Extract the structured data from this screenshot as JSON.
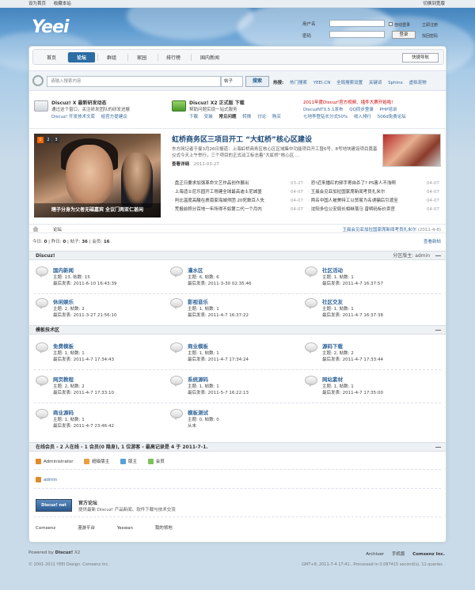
{
  "topbar": {
    "set_home": "设为首页",
    "bookmark": "收藏本站",
    "switch_style": "切换到宽版"
  },
  "logo": "Yeei",
  "login": {
    "username_label": "用户名",
    "password_label": "密码",
    "auto_login": "自动登录",
    "register": "立即注册",
    "forgot": "找回密码",
    "submit": "登录"
  },
  "nav": {
    "items": [
      "首页",
      "论坛",
      "群组",
      "家园",
      "排行榜",
      "国内新闻"
    ],
    "active": 1,
    "quicknav": "快捷导航"
  },
  "search": {
    "placeholder": "请输入搜索内容",
    "type": "帖子",
    "button": "搜索",
    "hot_label": "热搜:",
    "hot": [
      "热门搜索",
      "YEEI.CN",
      "全局搜索设置",
      "关键词",
      "Sphinx",
      "虚拟宠物"
    ]
  },
  "ads": {
    "col1": {
      "title": "Discuz! X 最新研发动态",
      "line1": "通过这个窗口，关注研发团队的研发进展",
      "links": [
        "Discuz! 开发技术文库",
        "给官方提建议"
      ]
    },
    "col2": {
      "title": "Discuz! X2 正式版 下载",
      "line1": "帮助问题实现一站式服务",
      "links": [
        "下载",
        "安装",
        "常见问题",
        "转换",
        "讨论",
        "购买"
      ]
    },
    "col3": {
      "line1": "2011年度Discuz!官方视频、插件大赛开始啦!",
      "line2": [
        "DiscuzNT3.5.1发布",
        "QQ同步登录",
        "PHP培训"
      ],
      "line3": [
        "七地李登钻长分式50%",
        "收入排行",
        "506d免费论坛"
      ]
    }
  },
  "slide": {
    "caption": "瞎子分身为父者无磁嘉宾  全议门两亚仁甚闲",
    "pages": [
      "1",
      "2",
      "3"
    ]
  },
  "headline": {
    "title": "虹桥商务区三项目开工 “大虹桥”核心区建设",
    "desc": "东方网记者于曼3月26日报道：上海虹桥商务区核心区区域集中功能项目开工暨6号、8号地块建设项目奠基仪式今天上午举行，三个项目的正式动工标志着“大虹桥”核心区 ...",
    "more": "查看详细",
    "date": "2011-03-27"
  },
  "news": {
    "col1": [
      {
        "title": "盘正日要求加强革命文艺作品创作展出",
        "date": "03-27"
      },
      {
        "title": "上海适士尼乐园开工得建全球最高迪士尼城堡",
        "date": "04-07"
      },
      {
        "title": "判比温度高酸在裹南家海城师团 20死数百人失",
        "date": "04-07"
      },
      {
        "title": "荒报前称分百地一年所得不如第二代一个月内",
        "date": "04-07"
      }
    ],
    "col2": [
      {
        "title": "恐!近来播红的频手寄自杀了? PS害人不浅啊",
        "date": "04-07"
      },
      {
        "title": "王晨会见亚加拉国家席新闻考员扎米尔",
        "date": "04-07"
      },
      {
        "title": "两名中国人被美特工以贸易为名诱骗后引渡至",
        "date": "04-07"
      },
      {
        "title": "沈阳多位公安局长相继落马 曾明码标价卖官",
        "date": "04-07"
      }
    ]
  },
  "statusbar": {
    "crumb": "论坛",
    "notice": "王晨会见亚加拉国家席新闻考员扎米尔",
    "notice_date": "(2011-4-8)"
  },
  "stats": {
    "today_label": "今日:",
    "today": "0",
    "yesterday_label": "昨日:",
    "yesterday": "0",
    "posts_label": "帖子:",
    "posts": "36",
    "members_label": "会员:",
    "members": "16",
    "new_posts": "查看新帖"
  },
  "cat1": {
    "title": "Discuz!",
    "moderator": "分区版主: admin",
    "forums": [
      {
        "name": "国内新闻",
        "l1": "主题: 13, 帖数: 15",
        "l2": "最后发表: 2011-6-10 16:43:39"
      },
      {
        "name": "灌水区",
        "l1": "主题: 6, 帖数: 6",
        "l2": "最后发表: 2011-3-30 02:35:46"
      },
      {
        "name": "社区活动",
        "l1": "主题: 1, 帖数: 1",
        "l2": "最后发表: 2011-4-7 16:37:57"
      },
      {
        "name": "休闲娱乐",
        "l1": "主题: 2, 帖数: 2",
        "l2": "最后发表: 2011-3-27 21:56:10"
      },
      {
        "name": "影视音乐",
        "l1": "主题: 1, 帖数: 1",
        "l2": "最后发表: 2011-4-7 16:37:22"
      },
      {
        "name": "社区交友",
        "l1": "主题: 1, 帖数: 1",
        "l2": "最后发表: 2011-4-7 16:37:38"
      }
    ]
  },
  "cat2": {
    "title": "模板技术区",
    "forums": [
      {
        "name": "免费模板",
        "l1": "主题: 1, 帖数: 1",
        "l2": "最后发表: 2011-4-7 17:34:43"
      },
      {
        "name": "商业模板",
        "l1": "主题: 1, 帖数: 1",
        "l2": "最后发表: 2011-4-7 17:34:24"
      },
      {
        "name": "源码下载",
        "l1": "主题: 2, 帖数: 2",
        "l2": "最后发表: 2011-4-7 17:33:44"
      },
      {
        "name": "网页教程",
        "l1": "主题: 2, 帖数: 2",
        "l2": "最后发表: 2011-4-7 17:33:10"
      },
      {
        "name": "系统源码",
        "l1": "主题: 1, 帖数: 1",
        "l2": "最后发表: 2011-5-7 16:22:13"
      },
      {
        "name": "网站素材",
        "l1": "主题: 1, 帖数: 1",
        "l2": "最后发表: 2011-4-7 17:35:00"
      },
      {
        "name": "商业源码",
        "l1": "主题: 1, 帖数: 1",
        "l2": "最后发表: 2011-4-7 23:46:42"
      },
      {
        "name": "模板测试",
        "l1": "主题: 0, 帖数: 0",
        "l2": "从未"
      }
    ]
  },
  "online": {
    "text": "在线会员 - 2 人在线 - 1 会员(0 隐身), 1 位游客 - 最高记录是 4 于 2011-7-1.",
    "legend": [
      "Administrator",
      "超级版主",
      "版主",
      "会员"
    ],
    "legend_colors": [
      "#e28a2a",
      "#e8a040",
      "#5a9fd5",
      "#7ac15a"
    ],
    "user": "admin"
  },
  "friendlink": {
    "logo": "Discuz! net",
    "name": "官方论坛",
    "desc": "提供最新 Discuz! 产品新闻、软件下载与技术交流"
  },
  "partners": [
    "Comsenz",
    "漫游平台",
    "Yeswan",
    "我的领地"
  ],
  "footer": {
    "powered": "Powered by",
    "product": "Discuz!",
    "version": "X2",
    "archiver": "Archiver",
    "mobile": "手机版",
    "company": "Comsenz Inc.",
    "copyright": "© 2001-2011 YEEI Design. Comsenz Inc.",
    "time": "GMT+8, 2011-7-4 17:41 , Processed in 0.087415 second(s), 11 queries ."
  }
}
